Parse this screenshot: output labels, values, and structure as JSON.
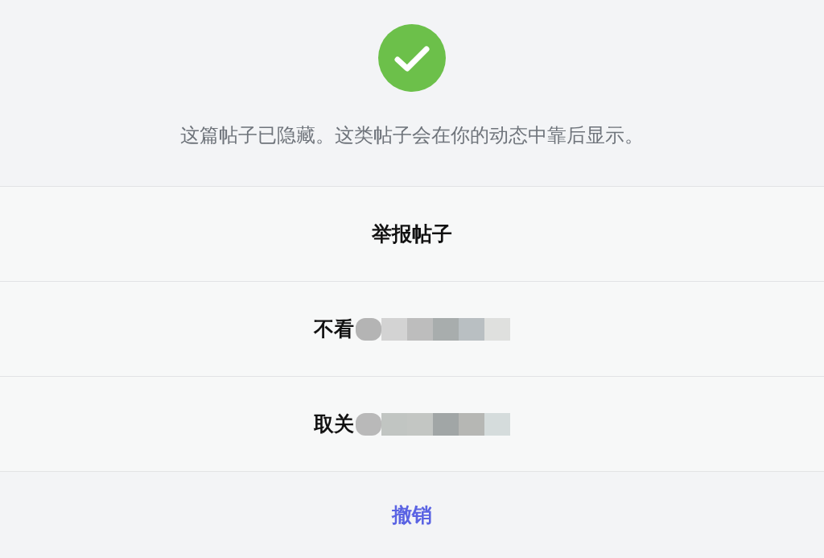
{
  "status": {
    "message": "这篇帖子已隐藏。这类帖子会在你的动态中靠后显示。"
  },
  "actions": [
    {
      "label": "举报帖子",
      "redacted": false
    },
    {
      "label": "不看",
      "redacted": true
    },
    {
      "label": "取关",
      "redacted": true
    }
  ],
  "cancel": {
    "label": "撤销"
  }
}
